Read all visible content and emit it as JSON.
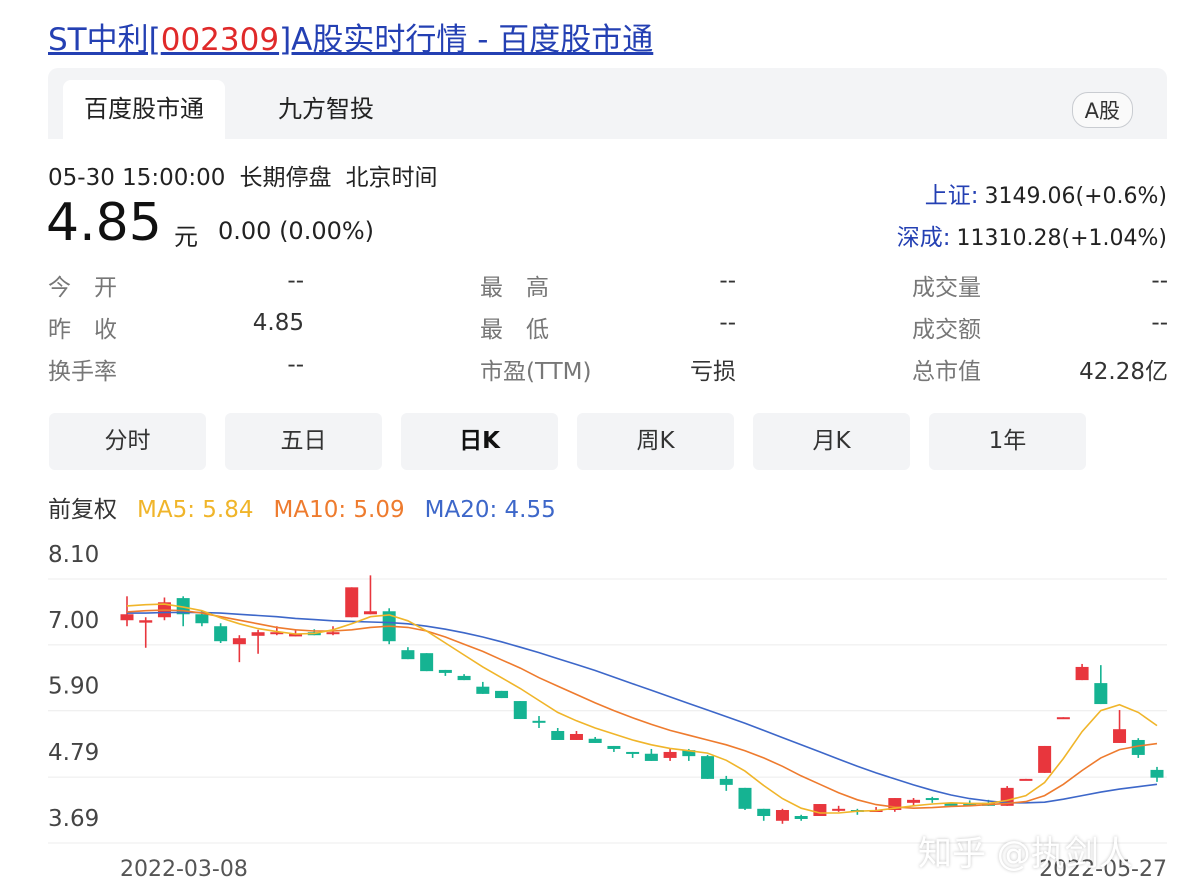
{
  "page": {
    "title_prefix": "ST中利[",
    "title_code": "002309",
    "title_suffix": "]A股实时行情 - 百度股市通"
  },
  "tabs": [
    "百度股市通",
    "九方智投"
  ],
  "market_badge": "A股",
  "status": {
    "time": "05-30 15:00:00",
    "state": "长期停盘",
    "tz": "北京时间"
  },
  "price": {
    "value": "4.85",
    "unit": "元",
    "change": "0.00 (0.00%)"
  },
  "indices": [
    {
      "name": "上证:",
      "value": "3149.06(+0.6%)"
    },
    {
      "name": "深成:",
      "value": "11310.28(+1.04%)"
    }
  ],
  "quote": [
    {
      "label": "今　开",
      "value": "--"
    },
    {
      "label": "最　高",
      "value": "--"
    },
    {
      "label": "成交量",
      "value": "--"
    },
    {
      "label": "昨　收",
      "value": "4.85"
    },
    {
      "label": "最　低",
      "value": "--"
    },
    {
      "label": "成交额",
      "value": "--"
    },
    {
      "label": "换手率",
      "value": "--"
    },
    {
      "label": "市盈(TTM)",
      "value": "亏损"
    },
    {
      "label": "总市值",
      "value": "42.28亿"
    }
  ],
  "periods": [
    "分时",
    "五日",
    "日K",
    "周K",
    "月K",
    "1年"
  ],
  "selected_period": "日K",
  "ma": {
    "adj_label": "前复权",
    "ma5": "MA5: 5.84",
    "ma10": "MA10: 5.09",
    "ma20": "MA20: 4.55"
  },
  "colors": {
    "up": "#e8363d",
    "down": "#15b392",
    "ma5": "#f0b52a",
    "ma10": "#ee7b2e",
    "ma20": "#3d67c9",
    "link": "#2440b3"
  },
  "watermark": "知乎 @执剑人",
  "chart_data": {
    "type": "candlestick",
    "y_ticks": [
      "8.10",
      "7.00",
      "5.90",
      "4.79",
      "3.69"
    ],
    "ylim": [
      3.69,
      8.1
    ],
    "x_labels": [
      "2022-03-08",
      "2022-05-27"
    ],
    "grid": true,
    "candles": [
      [
        6.96,
        7.06,
        7.36,
        6.86
      ],
      [
        6.92,
        6.96,
        7.01,
        6.5
      ],
      [
        7.01,
        7.26,
        7.34,
        6.96
      ],
      [
        7.33,
        7.06,
        7.36,
        6.86
      ],
      [
        7.06,
        6.91,
        7.11,
        6.86
      ],
      [
        6.86,
        6.61,
        6.91,
        6.58
      ],
      [
        6.56,
        6.66,
        6.71,
        6.26
      ],
      [
        6.7,
        6.76,
        6.8,
        6.4
      ],
      [
        6.73,
        6.76,
        6.86,
        6.71
      ],
      [
        6.69,
        6.73,
        6.81,
        6.69
      ],
      [
        6.76,
        6.71,
        6.81,
        6.71
      ],
      [
        6.73,
        6.76,
        6.86,
        6.71
      ],
      [
        7.01,
        7.51,
        7.51,
        7.01
      ],
      [
        7.06,
        7.11,
        7.71,
        7.06
      ],
      [
        7.11,
        6.61,
        7.16,
        6.56
      ],
      [
        6.46,
        6.31,
        6.51,
        6.31
      ],
      [
        6.41,
        6.11,
        6.41,
        6.11
      ],
      [
        6.13,
        6.08,
        6.13,
        6.03
      ],
      [
        6.03,
        5.96,
        6.06,
        5.96
      ],
      [
        5.85,
        5.73,
        5.93,
        5.73
      ],
      [
        5.78,
        5.66,
        5.78,
        5.66
      ],
      [
        5.61,
        5.31,
        5.61,
        5.31
      ],
      [
        5.28,
        5.26,
        5.36,
        5.16
      ],
      [
        5.11,
        4.96,
        5.16,
        4.96
      ],
      [
        4.96,
        5.06,
        5.11,
        4.96
      ],
      [
        4.98,
        4.91,
        5.01,
        4.91
      ],
      [
        4.86,
        4.81,
        4.86,
        4.76
      ],
      [
        4.76,
        4.73,
        4.76,
        4.66
      ],
      [
        4.73,
        4.61,
        4.81,
        4.61
      ],
      [
        4.66,
        4.76,
        4.81,
        4.61
      ],
      [
        4.79,
        4.69,
        4.81,
        4.61
      ],
      [
        4.69,
        4.31,
        4.71,
        4.31
      ],
      [
        4.31,
        4.21,
        4.36,
        4.11
      ],
      [
        4.16,
        3.81,
        4.16,
        3.79
      ],
      [
        3.81,
        3.69,
        3.81,
        3.61
      ],
      [
        3.61,
        3.79,
        3.81,
        3.56
      ],
      [
        3.69,
        3.64,
        3.71,
        3.61
      ],
      [
        3.69,
        3.89,
        3.89,
        3.69
      ],
      [
        3.79,
        3.81,
        3.86,
        3.76
      ],
      [
        3.79,
        3.76,
        3.81,
        3.71
      ],
      [
        3.77,
        3.79,
        3.84,
        3.76
      ],
      [
        3.79,
        3.99,
        3.99,
        3.76
      ],
      [
        3.91,
        3.96,
        3.99,
        3.86
      ],
      [
        3.99,
        3.96,
        4.01,
        3.91
      ],
      [
        3.91,
        3.86,
        3.91,
        3.86
      ],
      [
        3.89,
        3.88,
        3.95,
        3.86
      ],
      [
        3.91,
        3.86,
        3.96,
        3.86
      ],
      [
        3.86,
        4.16,
        4.19,
        3.86
      ],
      [
        4.29,
        4.31,
        4.31,
        4.29
      ],
      [
        4.41,
        4.86,
        4.86,
        4.41
      ],
      [
        5.31,
        5.34,
        5.34,
        5.31
      ],
      [
        5.96,
        6.18,
        6.23,
        5.96
      ],
      [
        5.91,
        5.56,
        6.21,
        5.56
      ],
      [
        4.91,
        5.14,
        5.46,
        4.91
      ],
      [
        4.96,
        4.71,
        4.99,
        4.66
      ],
      [
        4.46,
        4.33,
        4.51,
        4.26
      ]
    ],
    "ma5_series": [
      7.2,
      7.22,
      7.23,
      7.18,
      7.12,
      7.0,
      6.9,
      6.82,
      6.77,
      6.73,
      6.74,
      6.8,
      6.9,
      7.02,
      7.05,
      6.95,
      6.78,
      6.58,
      6.38,
      6.18,
      6.0,
      5.82,
      5.62,
      5.42,
      5.28,
      5.16,
      5.06,
      4.96,
      4.88,
      4.82,
      4.78,
      4.74,
      4.62,
      4.44,
      4.2,
      3.98,
      3.82,
      3.74,
      3.74,
      3.77,
      3.78,
      3.82,
      3.86,
      3.89,
      3.91,
      3.9,
      3.9,
      3.95,
      4.03,
      4.25,
      4.65,
      5.1,
      5.45,
      5.55,
      5.42,
      5.2
    ],
    "ma10_series": [
      7.1,
      7.12,
      7.13,
      7.12,
      7.08,
      7.02,
      6.96,
      6.9,
      6.84,
      6.8,
      6.78,
      6.78,
      6.8,
      6.84,
      6.86,
      6.84,
      6.78,
      6.68,
      6.56,
      6.44,
      6.3,
      6.16,
      6.0,
      5.86,
      5.72,
      5.58,
      5.45,
      5.33,
      5.22,
      5.12,
      5.04,
      4.96,
      4.88,
      4.78,
      4.66,
      4.52,
      4.36,
      4.22,
      4.08,
      3.96,
      3.88,
      3.84,
      3.82,
      3.83,
      3.85,
      3.86,
      3.88,
      3.9,
      3.93,
      4.03,
      4.22,
      4.45,
      4.66,
      4.8,
      4.86,
      4.9
    ],
    "ma20_series": [
      7.08,
      7.08,
      7.09,
      7.09,
      7.09,
      7.08,
      7.06,
      7.04,
      7.02,
      6.99,
      6.97,
      6.95,
      6.94,
      6.93,
      6.92,
      6.9,
      6.86,
      6.81,
      6.75,
      6.68,
      6.6,
      6.51,
      6.42,
      6.32,
      6.22,
      6.12,
      6.01,
      5.9,
      5.79,
      5.68,
      5.57,
      5.46,
      5.35,
      5.24,
      5.12,
      5.0,
      4.88,
      4.76,
      4.64,
      4.52,
      4.41,
      4.31,
      4.21,
      4.12,
      4.04,
      3.98,
      3.94,
      3.91,
      3.91,
      3.92,
      3.97,
      4.03,
      4.09,
      4.14,
      4.18,
      4.22
    ]
  }
}
